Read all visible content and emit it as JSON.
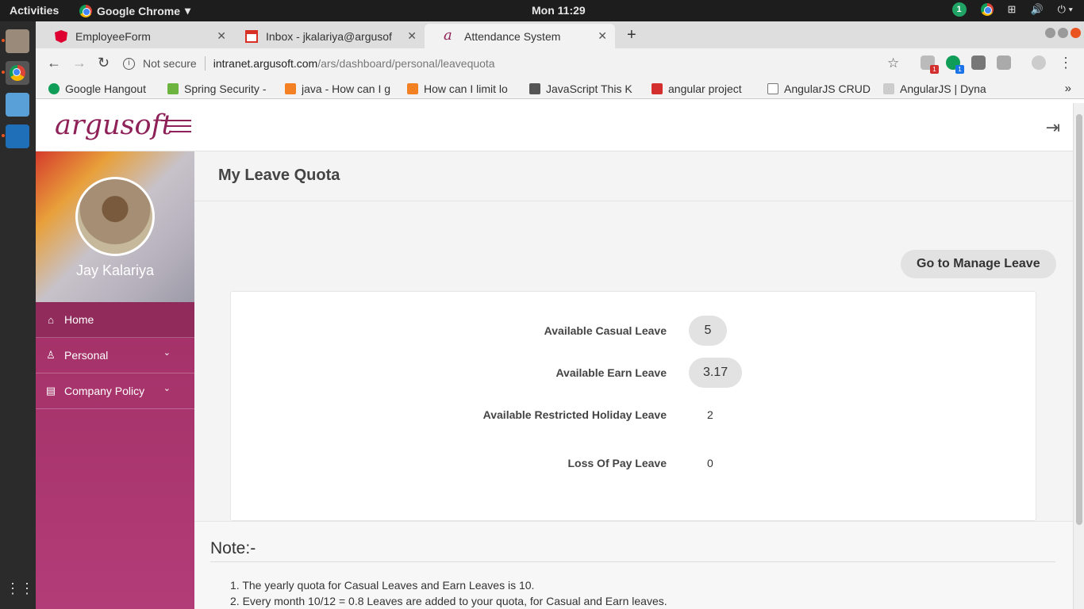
{
  "topbar": {
    "activities": "Activities",
    "app_menu": "Google Chrome",
    "clock": "Mon 11:29",
    "notification_count": "1"
  },
  "browser": {
    "tabs": [
      {
        "label": "EmployeeForm",
        "icon": "angular-icon",
        "icon_color": "#dd0031"
      },
      {
        "label": "Inbox - jkalariya@argusof",
        "icon": "gmail-icon",
        "icon_color": "#d93025"
      },
      {
        "label": "Attendance System",
        "icon": "argusoft-icon",
        "icon_color": "#8e2157"
      }
    ],
    "address": {
      "security_label": "Not secure",
      "host": "intranet.argusoft.com",
      "path": "/ars/dashboard/personal/leavequota"
    },
    "extension_badges": [
      "1",
      "1"
    ],
    "bookmarks": [
      {
        "label": "Google Hangout",
        "color": "#0f9d58"
      },
      {
        "label": "Spring Security -",
        "color": "#6db33f"
      },
      {
        "label": "java - How can I g",
        "color": "#f48024"
      },
      {
        "label": "How can I limit lo",
        "color": "#f48024"
      },
      {
        "label": "JavaScript This K",
        "color": "#555555"
      },
      {
        "label": "angular project",
        "color": "#d32f2f"
      },
      {
        "label": "AngularJS CRUD",
        "color": "#777777"
      },
      {
        "label": "AngularJS | Dyna",
        "color": "#888888"
      }
    ],
    "bookmarks_more": "»"
  },
  "app": {
    "brand": "argusoft",
    "user_name": "Jay Kalariya",
    "nav": [
      {
        "label": "Home",
        "icon": "home-icon",
        "glyph": "⌂"
      },
      {
        "label": "Personal",
        "icon": "user-icon",
        "glyph": "♙"
      },
      {
        "label": "Company Policy",
        "icon": "document-icon",
        "glyph": "▤"
      }
    ],
    "page_title": "My Leave Quota",
    "manage_button": "Go to Manage Leave",
    "quota": [
      {
        "label": "Available Casual Leave",
        "value": "5"
      },
      {
        "label": "Available Earn Leave",
        "value": "3.17"
      },
      {
        "label": "Available Restricted Holiday Leave",
        "value": "2"
      },
      {
        "label": "Loss Of Pay Leave",
        "value": "0"
      }
    ],
    "note_title": "Note:-",
    "notes": [
      "1. The yearly quota for Casual Leaves and Earn Leaves is 10.",
      "2. Every month 10/12 = 0.8 Leaves are added to your quota, for Casual and Earn leaves."
    ]
  },
  "colors": {
    "brand": "#8e2157",
    "sidebar_start": "#9c2b60",
    "sidebar_end": "#b23c77"
  }
}
